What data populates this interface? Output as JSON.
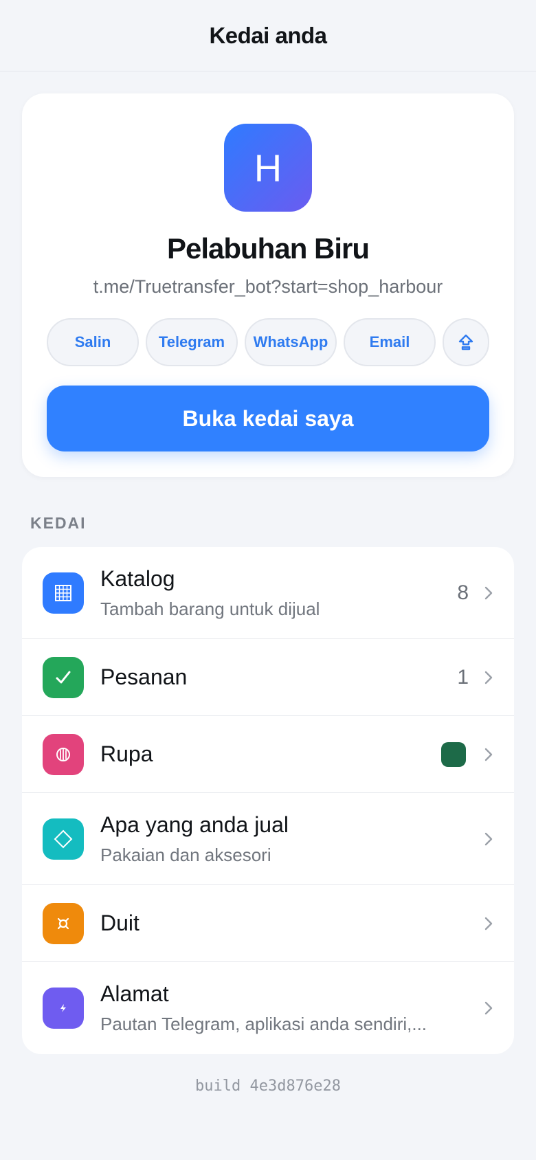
{
  "header": {
    "title": "Kedai anda"
  },
  "shop": {
    "avatar_letter": "H",
    "name": "Pelabuhan Biru",
    "link": "t.me/Truetransfer_bot?start=shop_harbour",
    "share": {
      "copy": "Salin",
      "telegram": "Telegram",
      "whatsapp": "WhatsApp",
      "email": "Email",
      "more_icon": "share-icon"
    },
    "open_button": "Buka kedai saya"
  },
  "section": {
    "label": "KEDAI"
  },
  "items": [
    {
      "title": "Katalog",
      "subtitle": "Tambah barang untuk dijual",
      "meta": "8",
      "icon": "grid-icon",
      "color": "#2f7bff"
    },
    {
      "title": "Pesanan",
      "meta": "1",
      "icon": "check-icon",
      "color": "#24a75a"
    },
    {
      "title": "Rupa",
      "icon": "palette-icon",
      "color": "#e2437c",
      "swatch": "#1d6a48"
    },
    {
      "title": "Apa yang anda jual",
      "subtitle": "Pakaian dan aksesori",
      "icon": "diamond-icon",
      "color": "#14bcc0"
    },
    {
      "title": "Duit",
      "icon": "currency-icon",
      "color": "#ef8a0c"
    },
    {
      "title": "Alamat",
      "subtitle": "Pautan Telegram, aplikasi anda sendiri,...",
      "icon": "link-icon",
      "color": "#6f5cf0"
    }
  ],
  "footer": {
    "build": "build 4e3d876e28"
  }
}
